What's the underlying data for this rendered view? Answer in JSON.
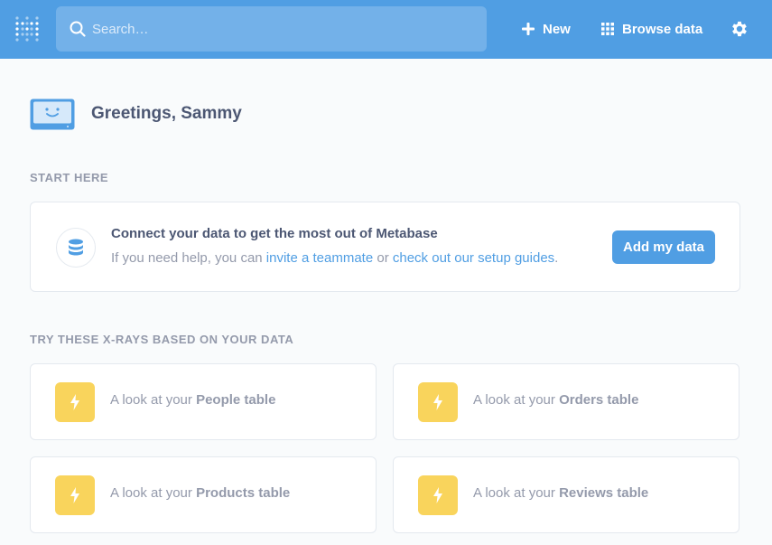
{
  "search": {
    "placeholder": "Search…"
  },
  "nav": {
    "new_label": "New",
    "browse_label": "Browse data"
  },
  "greeting": "Greetings, Sammy",
  "start_here": {
    "label": "START HERE",
    "title": "Connect your data to get the most out of Metabase",
    "help_prefix": "If you need help, you can",
    "invite_link": "invite a teammate",
    "or_text": "or",
    "setup_link": "check out our setup guides",
    "period": ".",
    "button": "Add my data"
  },
  "xrays": {
    "label": "TRY THESE X-RAYS BASED ON YOUR DATA",
    "prefix": "A look at your",
    "items": [
      {
        "name": "People table"
      },
      {
        "name": "Orders table"
      },
      {
        "name": "Products table"
      },
      {
        "name": "Reviews table"
      }
    ]
  },
  "colors": {
    "brand": "#509ee3",
    "xray_icon": "#f9d45c",
    "text_dark": "#4c5773",
    "text_light": "#949aab"
  }
}
